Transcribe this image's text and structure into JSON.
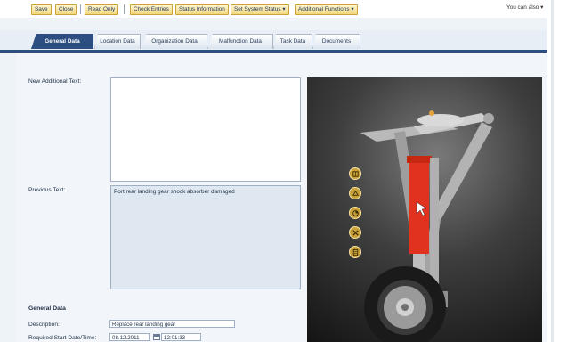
{
  "toolbar": {
    "save": "Save",
    "close": "Close",
    "read_only": "Read Only",
    "check_entries": "Check Entries",
    "status_information": "Status Information",
    "set_system_status": "Set System Status ▾",
    "additional_functions": "Additional Functions ▾",
    "you_can_also": "You can also ▾"
  },
  "tabs": [
    {
      "label": "General Data",
      "active": true
    },
    {
      "label": "Location Data",
      "active": false
    },
    {
      "label": "Organization Data",
      "active": false
    },
    {
      "label": "Malfunction Data",
      "active": false
    },
    {
      "label": "Task Data",
      "active": false
    },
    {
      "label": "Documents",
      "active": false
    }
  ],
  "form": {
    "new_additional_text_label": "New Additional Text:",
    "new_additional_text_value": "",
    "previous_text_label": "Previous Text:",
    "previous_text_value": "Port rear landing gear shock absorber damaged",
    "general_data_title": "General Data",
    "description_label": "Description:",
    "description_value": "Replace rear landing gear",
    "required_start_label": "Required Start Date/Time:",
    "required_start_date": "08.12.2011",
    "required_start_time": "12:01:33"
  },
  "viewer": {
    "tools": [
      "select-icon",
      "rotate-icon",
      "section-icon",
      "tools-icon",
      "document-icon"
    ],
    "colors": {
      "highlight": "#e0321e",
      "tool": "#c9a23a"
    }
  }
}
